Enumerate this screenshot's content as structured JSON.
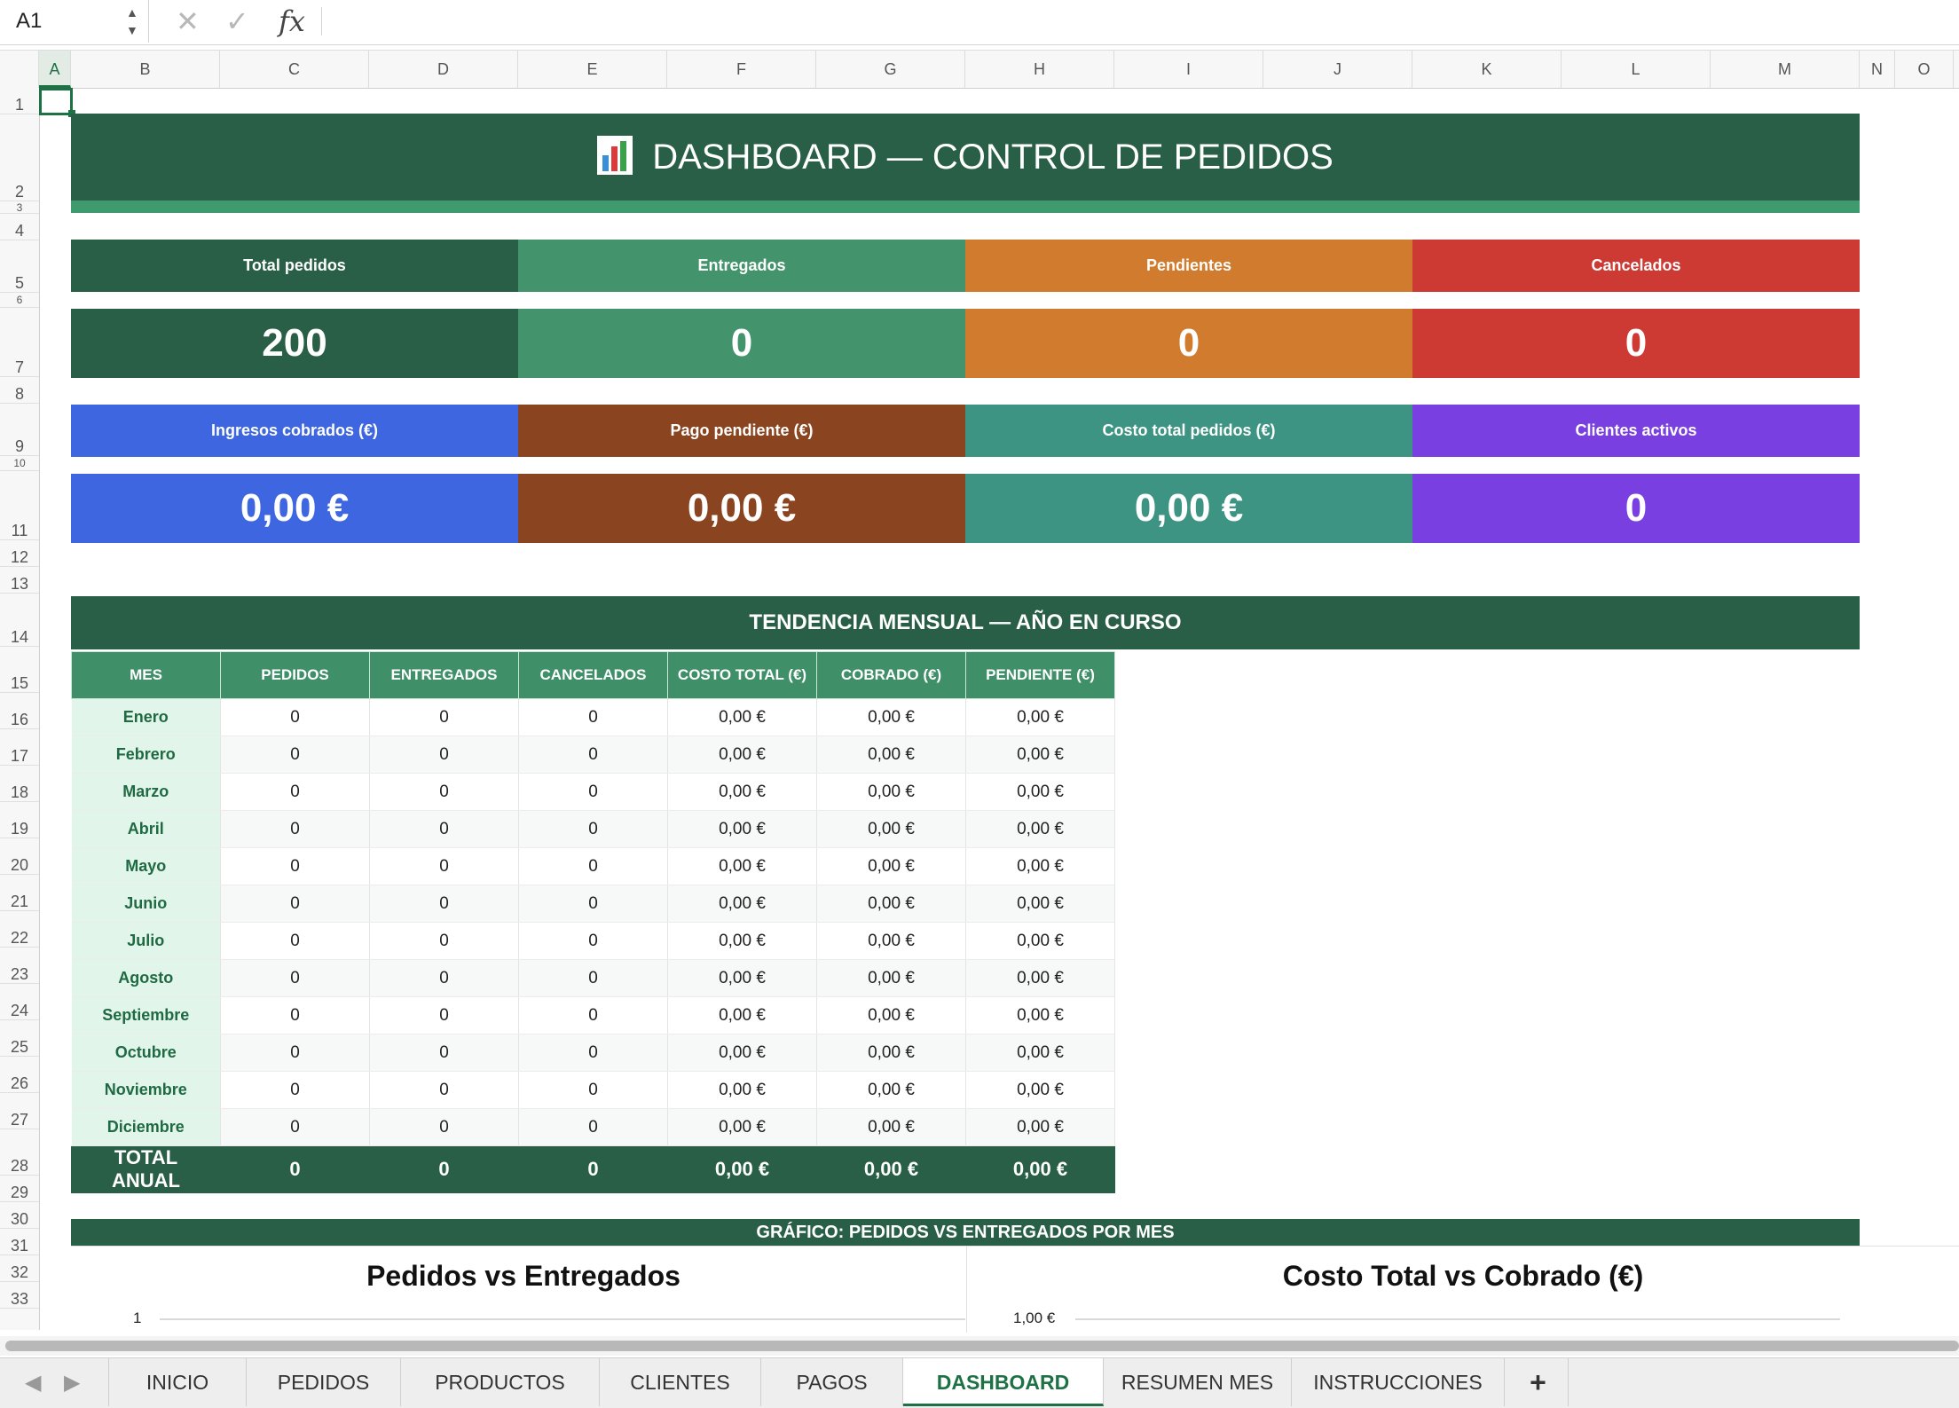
{
  "formula_bar": {
    "cell_ref": "A1",
    "cancel_icon": "✕",
    "confirm_icon": "✓",
    "fx_label": "fx",
    "formula": ""
  },
  "columns": [
    "A",
    "B",
    "C",
    "D",
    "E",
    "F",
    "G",
    "H",
    "I",
    "J",
    "K",
    "L",
    "M",
    "N",
    "O"
  ],
  "rows": [
    "1",
    "2",
    "3",
    "4",
    "5",
    "6",
    "7",
    "8",
    "9",
    "10",
    "11",
    "12",
    "13",
    "14",
    "15",
    "16",
    "17",
    "18",
    "19",
    "20",
    "21",
    "22",
    "23",
    "24",
    "25",
    "26",
    "27",
    "28",
    "29",
    "30",
    "31",
    "32",
    "33"
  ],
  "banner": {
    "icon": "bar-chart-icon",
    "title": "DASHBOARD — CONTROL DE PEDIDOS"
  },
  "kpis_row1": [
    {
      "label": "Total pedidos",
      "value": "200",
      "color": "#2a5f47"
    },
    {
      "label": "Entregados",
      "value": "0",
      "color": "#43946c"
    },
    {
      "label": "Pendientes",
      "value": "0",
      "color": "#d07b2e"
    },
    {
      "label": "Cancelados",
      "value": "0",
      "color": "#cc3a33"
    }
  ],
  "kpis_row2": [
    {
      "label": "Ingresos cobrados (€)",
      "value": "0,00 €",
      "color": "#3e66e0"
    },
    {
      "label": "Pago pendiente (€)",
      "value": "0,00 €",
      "color": "#8a4520"
    },
    {
      "label": "Costo total pedidos (€)",
      "value": "0,00 €",
      "color": "#3e9483"
    },
    {
      "label": "Clientes activos",
      "value": "0",
      "color": "#7a3fe0"
    }
  ],
  "trend": {
    "title": "TENDENCIA MENSUAL — AÑO EN CURSO",
    "headers": [
      "MES",
      "PEDIDOS",
      "ENTREGADOS",
      "CANCELADOS",
      "COSTO TOTAL (€)",
      "COBRADO (€)",
      "PENDIENTE (€)"
    ],
    "rows": [
      [
        "Enero",
        "0",
        "0",
        "0",
        "0,00 €",
        "0,00 €",
        "0,00 €"
      ],
      [
        "Febrero",
        "0",
        "0",
        "0",
        "0,00 €",
        "0,00 €",
        "0,00 €"
      ],
      [
        "Marzo",
        "0",
        "0",
        "0",
        "0,00 €",
        "0,00 €",
        "0,00 €"
      ],
      [
        "Abril",
        "0",
        "0",
        "0",
        "0,00 €",
        "0,00 €",
        "0,00 €"
      ],
      [
        "Mayo",
        "0",
        "0",
        "0",
        "0,00 €",
        "0,00 €",
        "0,00 €"
      ],
      [
        "Junio",
        "0",
        "0",
        "0",
        "0,00 €",
        "0,00 €",
        "0,00 €"
      ],
      [
        "Julio",
        "0",
        "0",
        "0",
        "0,00 €",
        "0,00 €",
        "0,00 €"
      ],
      [
        "Agosto",
        "0",
        "0",
        "0",
        "0,00 €",
        "0,00 €",
        "0,00 €"
      ],
      [
        "Septiembre",
        "0",
        "0",
        "0",
        "0,00 €",
        "0,00 €",
        "0,00 €"
      ],
      [
        "Octubre",
        "0",
        "0",
        "0",
        "0,00 €",
        "0,00 €",
        "0,00 €"
      ],
      [
        "Noviembre",
        "0",
        "0",
        "0",
        "0,00 €",
        "0,00 €",
        "0,00 €"
      ],
      [
        "Diciembre",
        "0",
        "0",
        "0",
        "0,00 €",
        "0,00 €",
        "0,00 €"
      ]
    ],
    "total": {
      "label_line1": "TOTAL",
      "label_line2": "ANUAL",
      "values": [
        "0",
        "0",
        "0",
        "0,00 €",
        "0,00 €",
        "0,00 €"
      ]
    }
  },
  "chart_section": {
    "title": "GRÁFICO: PEDIDOS VS ENTREGADOS POR MES",
    "chart1_title": "Pedidos vs Entregados",
    "chart1_top_tick": "1",
    "chart2_title": "Costo Total vs Cobrado (€)",
    "chart2_top_tick": "1,00 €"
  },
  "sheet_tabs": [
    "INICIO",
    "PEDIDOS",
    "PRODUCTOS",
    "CLIENTES",
    "PAGOS",
    "DASHBOARD",
    "RESUMEN MES",
    "INSTRUCCIONES"
  ],
  "active_tab": "DASHBOARD",
  "add_sheet_label": "+",
  "nav": {
    "prev": "◀",
    "next": "▶"
  }
}
